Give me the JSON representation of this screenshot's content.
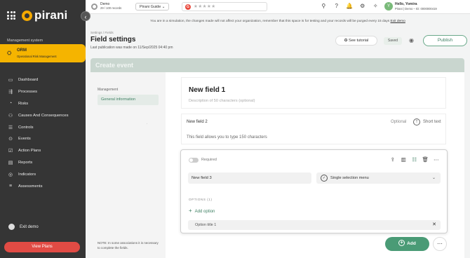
{
  "app": {
    "logo_text": "pirani",
    "collapse_glyph": "‹"
  },
  "sidebar": {
    "section_label": "Management system",
    "active_module": {
      "title": "ORM",
      "subtitle": "Operational Risk Management",
      "icon": "orm-icon"
    },
    "items": [
      {
        "label": "Dashboard",
        "icon": "dashboard-icon",
        "glyph": "▭"
      },
      {
        "label": "Processes",
        "icon": "processes-icon",
        "glyph": "⇶"
      },
      {
        "label": "Risks",
        "icon": "risks-icon",
        "glyph": "◔"
      },
      {
        "label": "Causes And Consequences",
        "icon": "causes-icon",
        "glyph": "⚇"
      },
      {
        "label": "Controls",
        "icon": "controls-icon",
        "glyph": "☰"
      },
      {
        "label": "Events",
        "icon": "events-icon",
        "glyph": "⊙"
      },
      {
        "label": "Action Plans",
        "icon": "action-plans-icon",
        "glyph": "☑"
      },
      {
        "label": "Reports",
        "icon": "reports-icon",
        "glyph": "▤"
      },
      {
        "label": "Indicators",
        "icon": "indicators-icon",
        "glyph": "◎"
      },
      {
        "label": "Assessments",
        "icon": "assessments-icon",
        "glyph": "≡"
      }
    ],
    "exit_demo": "Exit demo",
    "view_plans": "View Plans"
  },
  "topbar": {
    "demo_title": "Demo",
    "demo_records": "29 / 100 records",
    "guide_button": "Pirani Guide ⌄",
    "g_letter": "G",
    "rating_stars": "★★★★★",
    "icons": [
      "add-user-icon",
      "help-icon",
      "bell-icon",
      "settings-icon",
      "magic-icon"
    ],
    "icon_glyphs": [
      "⚲",
      "?",
      "🔔",
      "⚙",
      "✧"
    ],
    "user_initial": "Y",
    "user_hello": "Hello, Yomira",
    "user_org": "Pirani | Demo – ID: 0000000419"
  },
  "banner": {
    "text": "You are in a simulation, the changes made will not affect your organization, remember that this space is for testing and your records will be purged every 15 days",
    "link": "Exit demo"
  },
  "header": {
    "breadcrumb": "Settings / Fields",
    "title": "Field settings",
    "last_publication": "Last publication was made on 11/Sep/2025 04:40 pm",
    "tutorial_label": "✪ See tutorial",
    "saved_label": "Saved",
    "eye_glyph": "◉",
    "publish_label": "Publish"
  },
  "create_event": {
    "title": "Create event"
  },
  "left_panel": {
    "label": "Management",
    "item": "General information",
    "dot": ".",
    "note": "NOTE: In some associations it is necessary to complete the fields."
  },
  "field1": {
    "title": "New field 1",
    "description": "Description of 50 characters (optional)"
  },
  "field2": {
    "title": "New field 2",
    "optional": "Optional",
    "type_glyph": "T",
    "type": "Short text",
    "description": "This field allows you to type 150 characters"
  },
  "field3": {
    "required_label": "Required",
    "required_on": false,
    "tool_icons": [
      "upload-icon",
      "columns-icon",
      "rows-icon",
      "trash-icon",
      "more-icon"
    ],
    "tool_glyphs": [
      "⇪",
      "▥",
      "☷",
      "🗑",
      "⋯"
    ],
    "name": "New field 3",
    "type_glyph": "✓",
    "type": "Single selection menu",
    "chevron": "⌄",
    "options_label": "OPTIONS (1)",
    "add_option_glyph": "+",
    "add_option": "Add option",
    "option_1": "Option title 1",
    "remove_glyph": "✕"
  },
  "footer": {
    "add_glyph": "+",
    "add_label": "Add",
    "more_glyph": "⋯"
  },
  "colors": {
    "sidebar_bg": "#353535",
    "accent_yellow": "#f5b400",
    "brand_green": "#4a9b76",
    "danger": "#e14b44"
  }
}
